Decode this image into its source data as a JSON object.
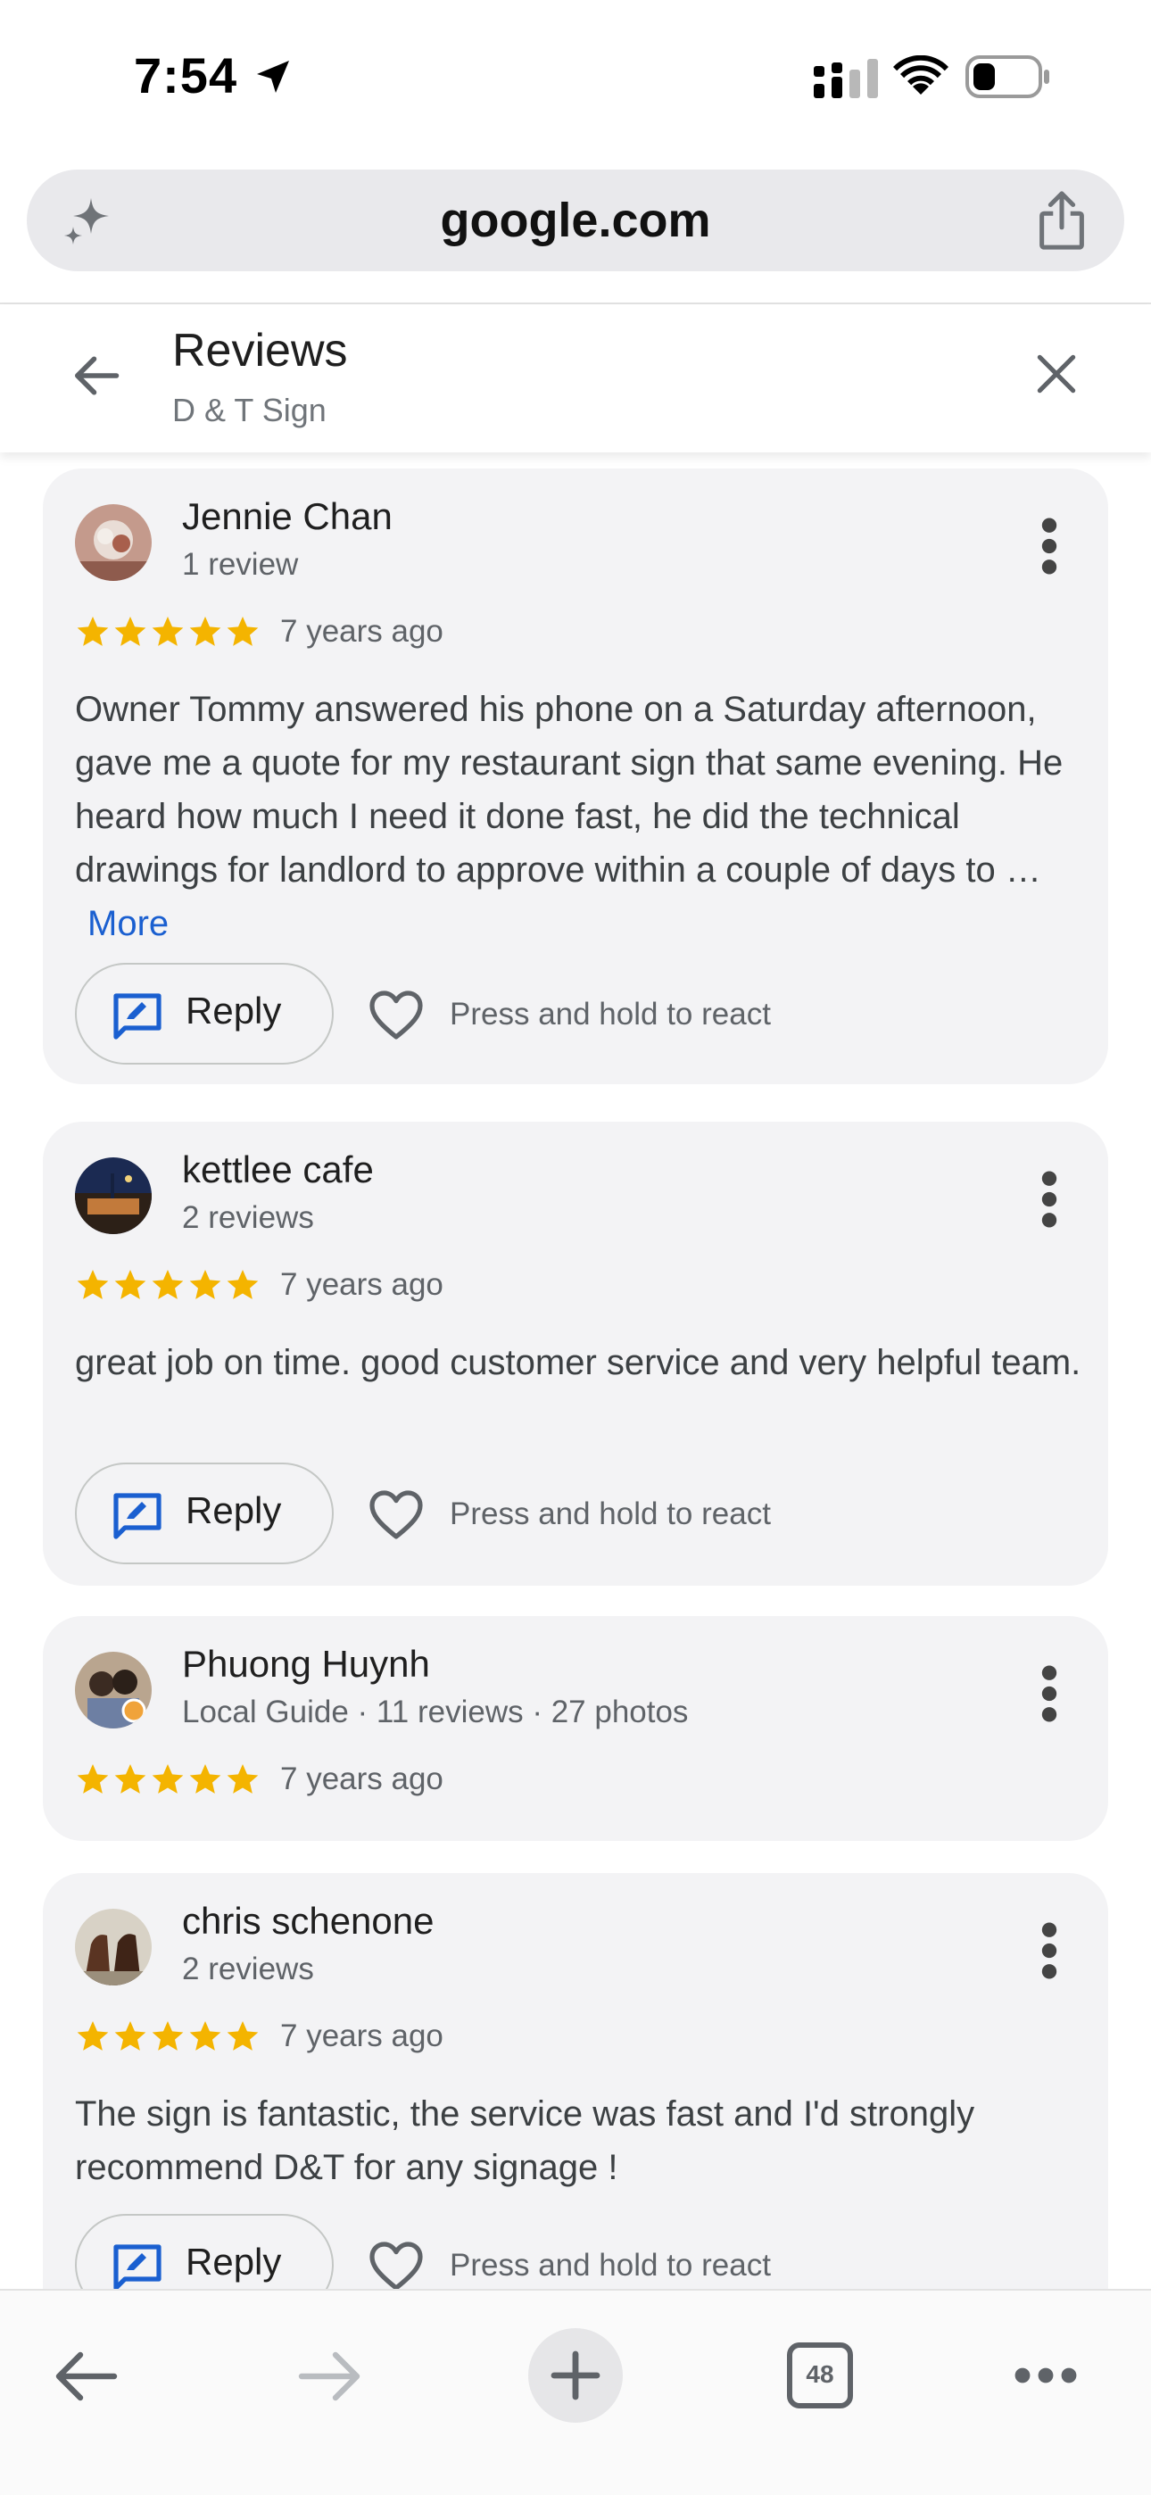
{
  "status_bar": {
    "time": "7:54"
  },
  "browser": {
    "url": "google.com",
    "open_tabs": "48"
  },
  "reviews_header": {
    "title": "Reviews",
    "subtitle": "D & T Sign"
  },
  "reviews": [
    {
      "name": "Jennie Chan",
      "meta": "1 review",
      "rating": 5,
      "age": "7 years ago",
      "text": "Owner Tommy answered his phone on a Saturday afternoon, gave me a quote for my restaurant sign that same evening. He heard how much I need it done fast, he did the technical drawings for landlord to approve within a couple of days to …",
      "more_label": "More",
      "reply_label": "Reply",
      "react_hint": "Press and hold to react"
    },
    {
      "name": "kettlee cafe",
      "meta": "2 reviews",
      "rating": 5,
      "age": "7 years ago",
      "text": "great job on time. good customer service and very helpful team.",
      "reply_label": "Reply",
      "react_hint": "Press and hold to react"
    },
    {
      "name": "Phuong Huynh",
      "meta": "Local Guide · 11 reviews · 27 photos",
      "rating": 5,
      "age": "7 years ago"
    },
    {
      "name": "chris schenone",
      "meta": "2 reviews",
      "rating": 5,
      "age": "7 years ago",
      "text": "The sign is fantastic, the service was fast and I'd strongly recommend D&T for any signage !",
      "reply_label": "Reply",
      "react_hint": "Press and hold to react"
    }
  ],
  "colors": {
    "star": "#f4b400",
    "link": "#1a5fd0",
    "card_bg": "#f3f3f5",
    "reply_icon": "#1a5fd0"
  },
  "icons": [
    "location-arrow-icon",
    "signal-icon",
    "wifi-icon",
    "battery-icon",
    "sparkle-icon",
    "share-icon",
    "back-arrow-icon",
    "close-icon",
    "more-vert-icon",
    "star-icon",
    "reply-icon",
    "heart-icon",
    "plus-icon",
    "tabs-icon",
    "more-horiz-icon"
  ]
}
